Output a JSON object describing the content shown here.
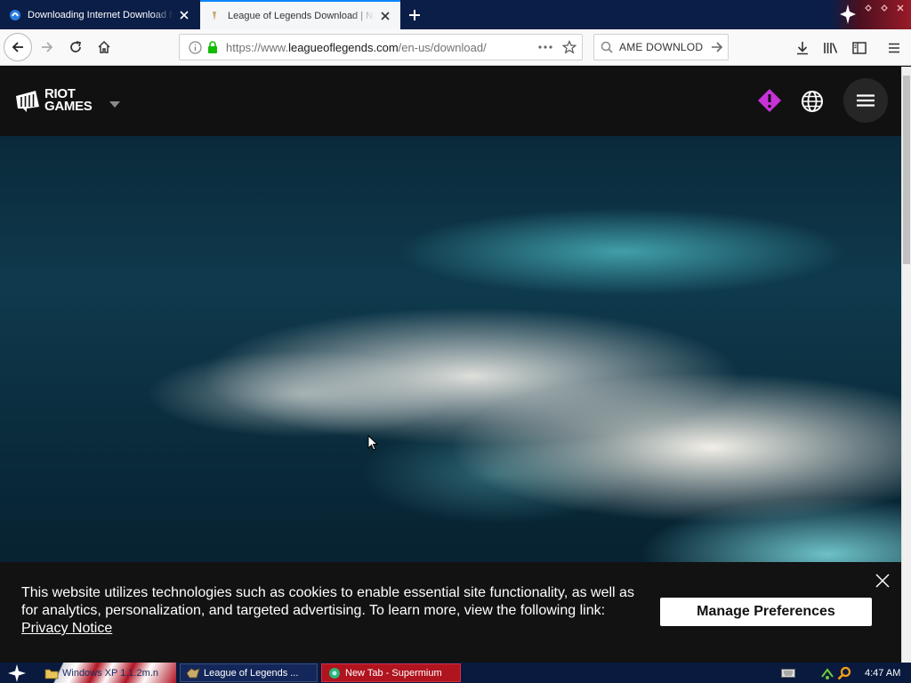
{
  "browser": {
    "tabs": [
      {
        "title": "Downloading Internet Download M",
        "active": false,
        "favicon": "idm-icon"
      },
      {
        "title": "League of Legends Download | Na",
        "active": true,
        "favicon": "riot-favicon"
      }
    ],
    "url": {
      "prefix": "https://www.",
      "domain": "leagueoflegends.com",
      "path": "/en-us/download/"
    },
    "search_text": "AME DOWNLOD"
  },
  "header": {
    "logo_line1": "RIOT",
    "logo_line2": "GAMES",
    "alert_color": "#c832d8"
  },
  "cookie_banner": {
    "message": "This website utilizes technologies such as cookies to enable essential site functionality, as well as for analytics, personalization, and targeted advertising. To learn more, view the following link:",
    "link_text": "Privacy Notice",
    "button_label": "Manage Preferences"
  },
  "taskbar": {
    "items": [
      {
        "label": "Windows XP 1.1.2m.n",
        "icon": "folder-icon"
      },
      {
        "label": "League of Legends ...",
        "icon": "app-icon"
      },
      {
        "label": "New Tab - Supermium",
        "icon": "supermium-icon"
      }
    ],
    "clock": "4:47 AM"
  },
  "colors": {
    "tabstrip_bg": "#0b1e47",
    "taskbar_bg": "#0a1a3f",
    "accent": "#0a84ff",
    "lock_green": "#12bc00"
  }
}
